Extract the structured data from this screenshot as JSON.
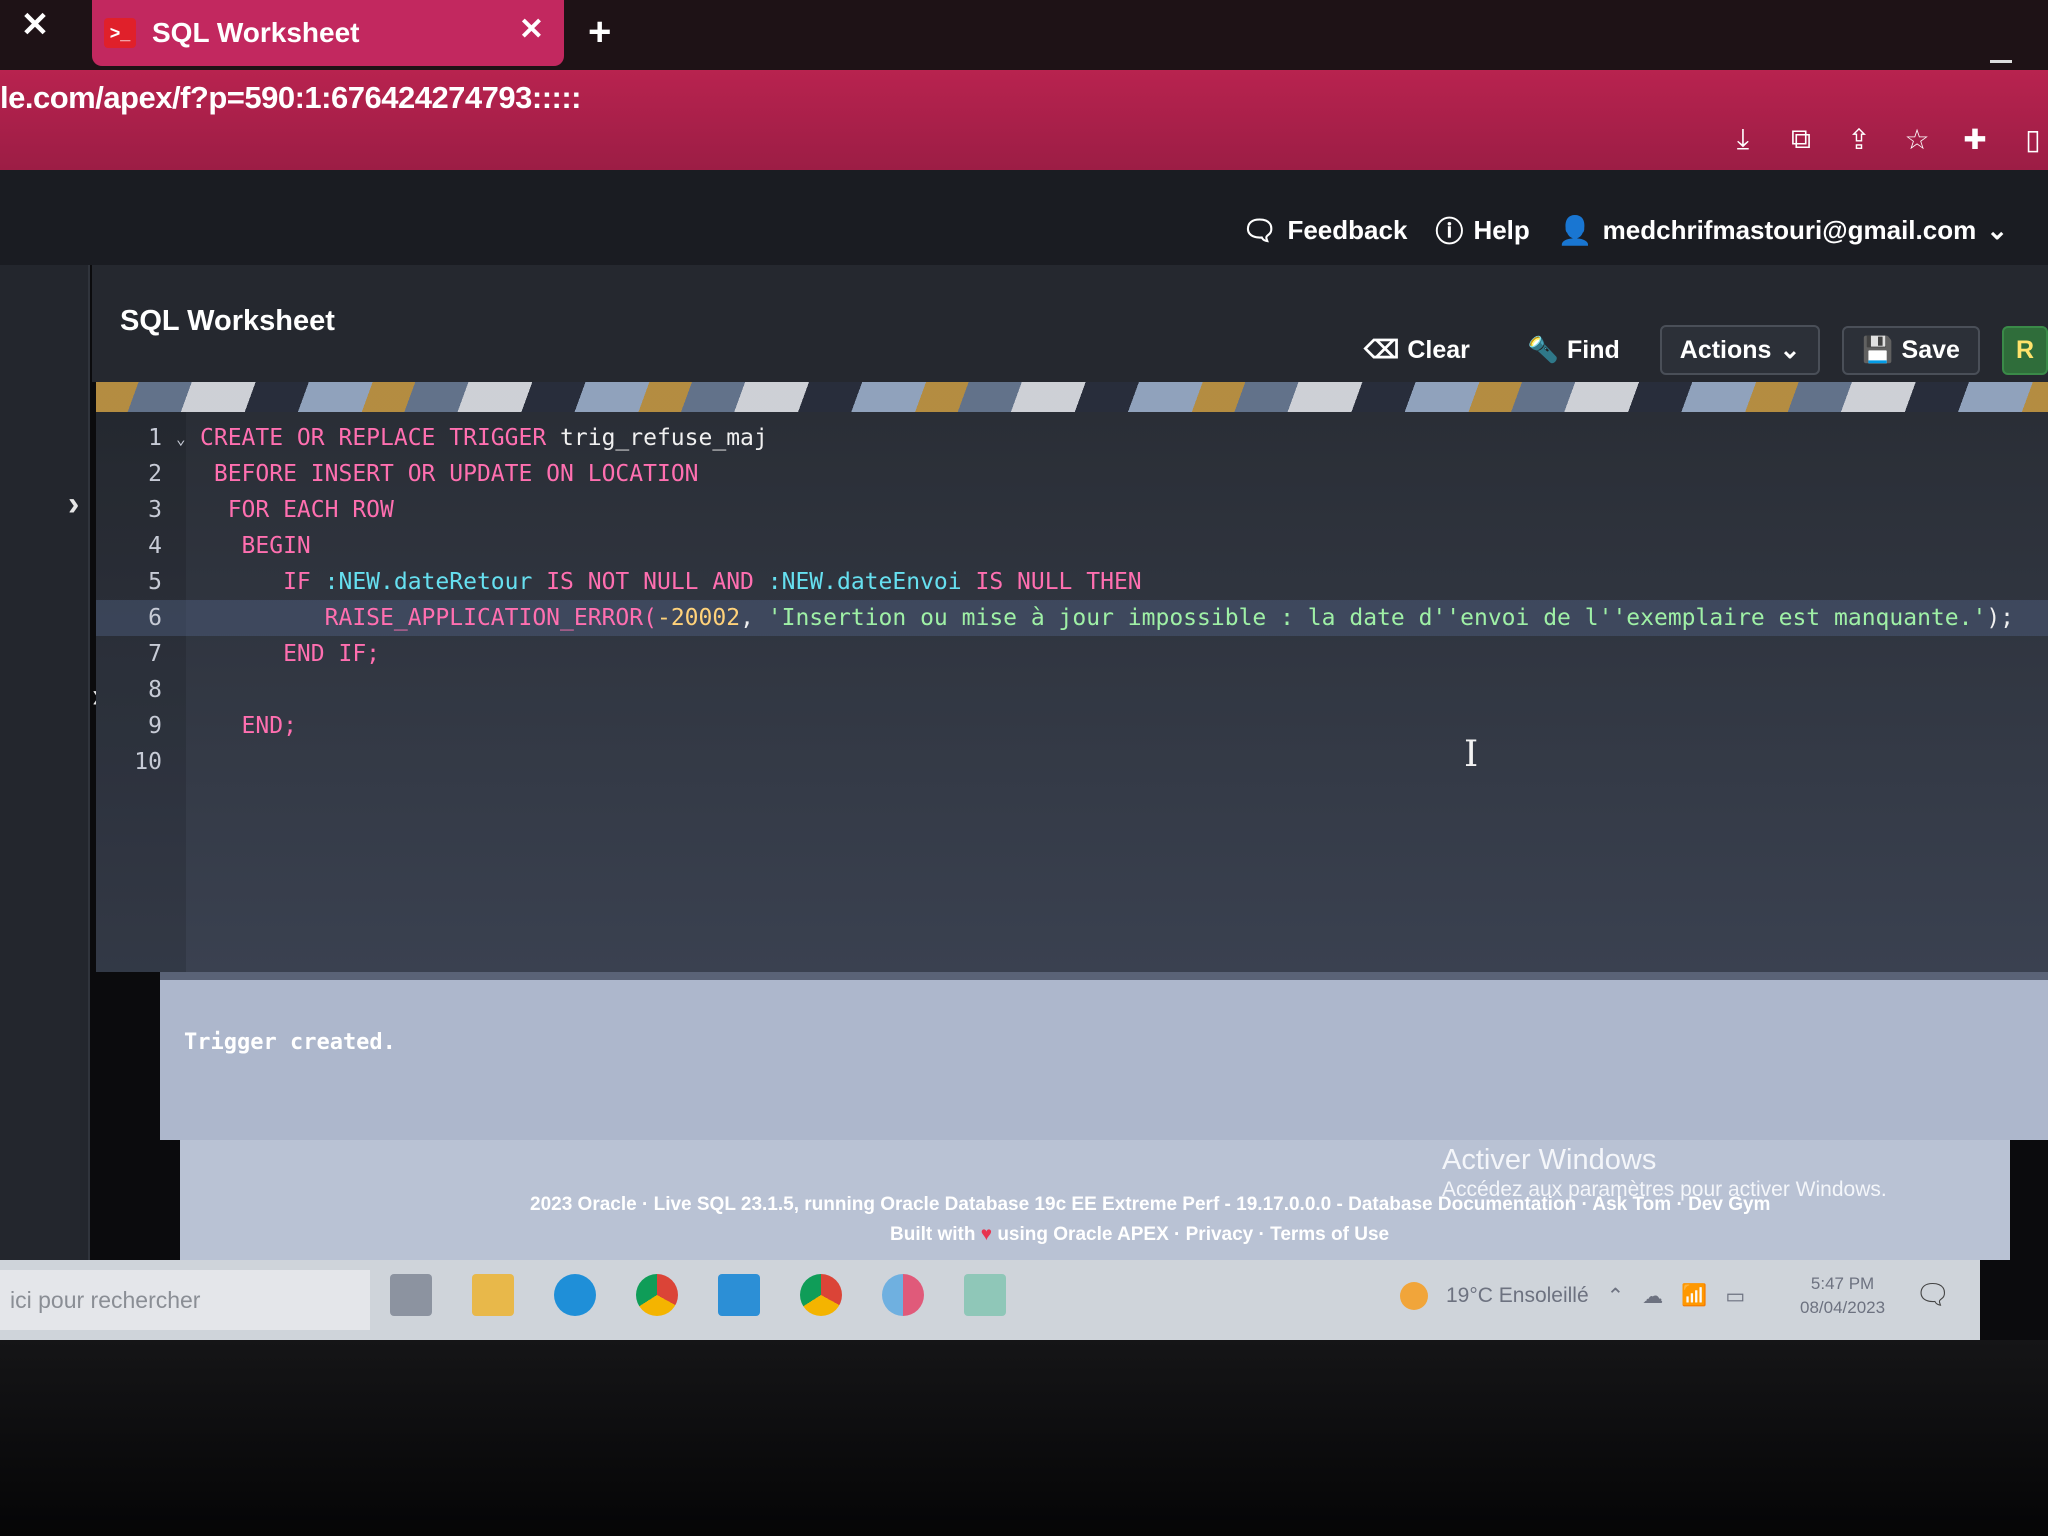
{
  "browser": {
    "tab_title": "SQL Worksheet",
    "tab_favicon": ">_",
    "url": "le.com/apex/f?p=590:1:676424274793:::::"
  },
  "header": {
    "feedback": "Feedback",
    "help": "Help",
    "user": "medchrifmastouri@gmail.com"
  },
  "worksheet": {
    "title": "SQL Worksheet",
    "clear": "Clear",
    "find": "Find",
    "actions": "Actions",
    "save": "Save",
    "run": "R"
  },
  "editor": {
    "lines": [
      {
        "n": "1",
        "tokens": [
          [
            "kw",
            "CREATE OR REPLACE TRIGGER "
          ],
          [
            "code",
            "trig_refuse_maj"
          ]
        ]
      },
      {
        "n": "2",
        "tokens": [
          [
            "kw",
            " BEFORE INSERT OR UPDATE ON "
          ],
          [
            "kw",
            "LOCATION"
          ]
        ]
      },
      {
        "n": "3",
        "tokens": [
          [
            "kw",
            "  FOR EACH ROW"
          ]
        ]
      },
      {
        "n": "4",
        "tokens": [
          [
            "kw",
            "   BEGIN"
          ]
        ]
      },
      {
        "n": "5",
        "tokens": [
          [
            "kw",
            "      IF "
          ],
          [
            "bind",
            ":NEW.dateRetour"
          ],
          [
            "kw",
            " IS NOT NULL AND "
          ],
          [
            "bind",
            ":NEW.dateEnvoi"
          ],
          [
            "kw",
            " IS NULL THEN"
          ]
        ]
      },
      {
        "n": "6",
        "tokens": [
          [
            "kw",
            "         RAISE_APPLICATION_ERROR("
          ],
          [
            "num",
            "-20002"
          ],
          [
            "code",
            ", "
          ],
          [
            "str",
            "'Insertion ou mise à jour impossible : la date d''envoi de l''exemplaire est manquante.'"
          ],
          [
            "code",
            ");"
          ]
        ]
      },
      {
        "n": "7",
        "tokens": [
          [
            "kw",
            "      END IF;"
          ]
        ]
      },
      {
        "n": "8",
        "tokens": []
      },
      {
        "n": "9",
        "tokens": [
          [
            "kw",
            "   END;"
          ]
        ]
      },
      {
        "n": "10",
        "tokens": []
      }
    ],
    "active_line": 6
  },
  "output": {
    "message": "Trigger created."
  },
  "footer": {
    "line1": "2023 Oracle · Live SQL 23.1.5, running Oracle Database 19c EE Extreme Perf - 19.17.0.0.0 - Database Documentation · Ask Tom · Dev Gym",
    "built_with": "Built with",
    "line2_rest": "using Oracle APEX · Privacy · Terms of Use"
  },
  "windows_activation": {
    "title": "Activer Windows",
    "subtitle": "Accédez aux paramètres pour activer Windows."
  },
  "taskbar": {
    "search_placeholder": "ici pour rechercher",
    "weather": "19°C  Ensoleillé",
    "time": "5:47 PM",
    "date": "08/04/2023"
  },
  "colors": {
    "tab_accent": "#c2285f",
    "keyword": "#ff6fb0",
    "bind_variable": "#66e0f0",
    "string_literal": "#9ff0a6"
  }
}
